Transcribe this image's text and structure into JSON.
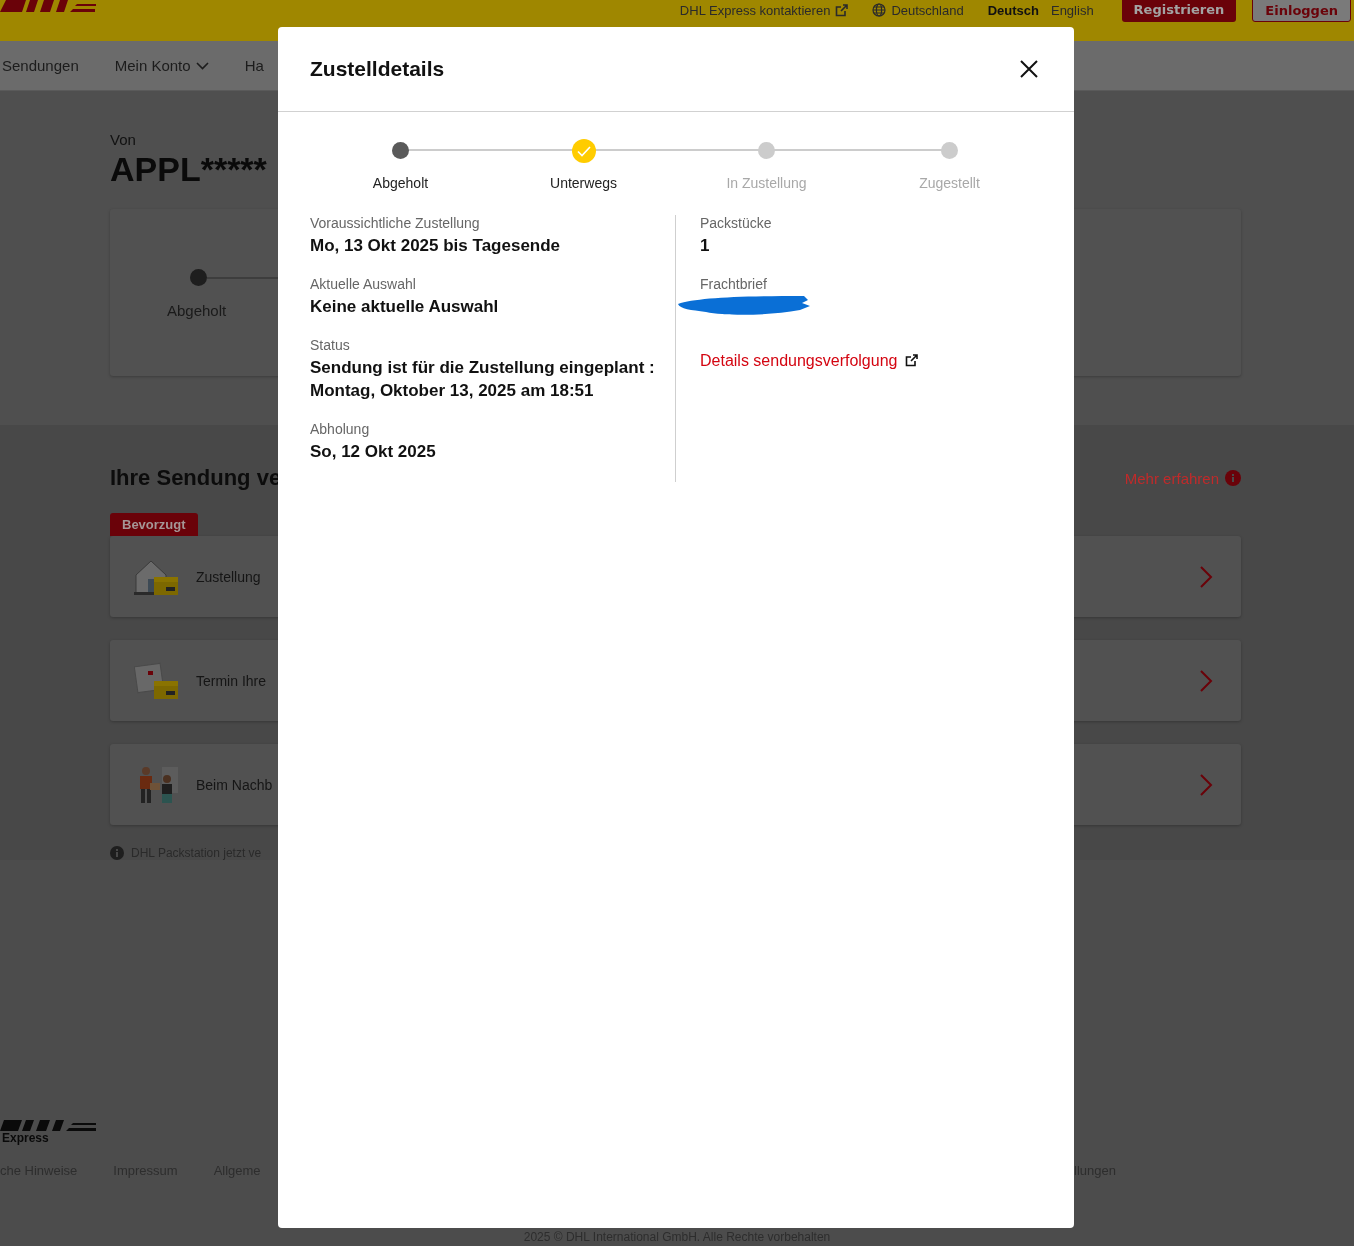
{
  "header": {
    "links": [
      {
        "label": "DHL Express kontaktieren",
        "kind": "external"
      },
      {
        "label": "Deutschland",
        "kind": "country"
      }
    ],
    "languages": [
      {
        "label": "Deutsch",
        "selected": true
      },
      {
        "label": "English",
        "selected": false
      }
    ],
    "buttons": [
      {
        "label": "Registrieren",
        "kind": "primary"
      },
      {
        "label": "Einloggen",
        "kind": "secondary"
      }
    ]
  },
  "nav": [
    {
      "label": "Sendungen",
      "has_menu": false
    },
    {
      "label": "Mein Konto",
      "has_menu": true
    },
    {
      "label": "Ha",
      "has_menu": false
    }
  ],
  "shipment": {
    "from_label": "Von",
    "sender": "APPL*****",
    "progress": [
      {
        "label": "Abgeholt"
      }
    ]
  },
  "services": {
    "title": "Ihre Sendung ve",
    "learn_more": "Mehr erfahren",
    "badge": "Bevorzugt",
    "options": [
      {
        "label": "Zustellung",
        "kind": "house"
      },
      {
        "label": "Termin Ihre",
        "kind": "calendar"
      },
      {
        "label": "Beim Nachb",
        "kind": "handover"
      }
    ],
    "note": "DHL Packstation jetzt ve"
  },
  "footer": {
    "brand": "Express",
    "links": [
      "che Hinweise",
      "Impressum",
      "Allgeme"
    ],
    "right_links": [
      "llungen"
    ],
    "copyright": "2025 © DHL International GmbH. Alle Rechte vorbehalten"
  },
  "dialog": {
    "title": "Zustelldetails",
    "steps": [
      {
        "label": "Abgeholt",
        "completed": true,
        "active": false
      },
      {
        "label": "Unterwegs",
        "completed": true,
        "active": true
      },
      {
        "label": "In Zustellung",
        "completed": false,
        "active": false
      },
      {
        "label": "Zugestellt",
        "completed": false,
        "active": false
      }
    ],
    "details": [
      {
        "label": "Voraussichtliche Zustellung",
        "value": "Mo, 13 Okt 2025 bis Tagesende"
      },
      {
        "label": "Aktuelle Auswahl",
        "value": "Keine aktuelle Auswahl"
      },
      {
        "label": "Status",
        "value": "Sendung ist für die Zustellung eingeplant : Montag, Oktober 13, 2025 am 18:51"
      },
      {
        "label": "Abholung",
        "value": "So, 12 Okt 2025"
      }
    ],
    "side_details": [
      {
        "label": "Packstücke",
        "value": "1",
        "redacted": false
      },
      {
        "label": "Frachtbrief",
        "redacted": true
      }
    ],
    "tracking_link": "Details sendungsverfolgung"
  }
}
